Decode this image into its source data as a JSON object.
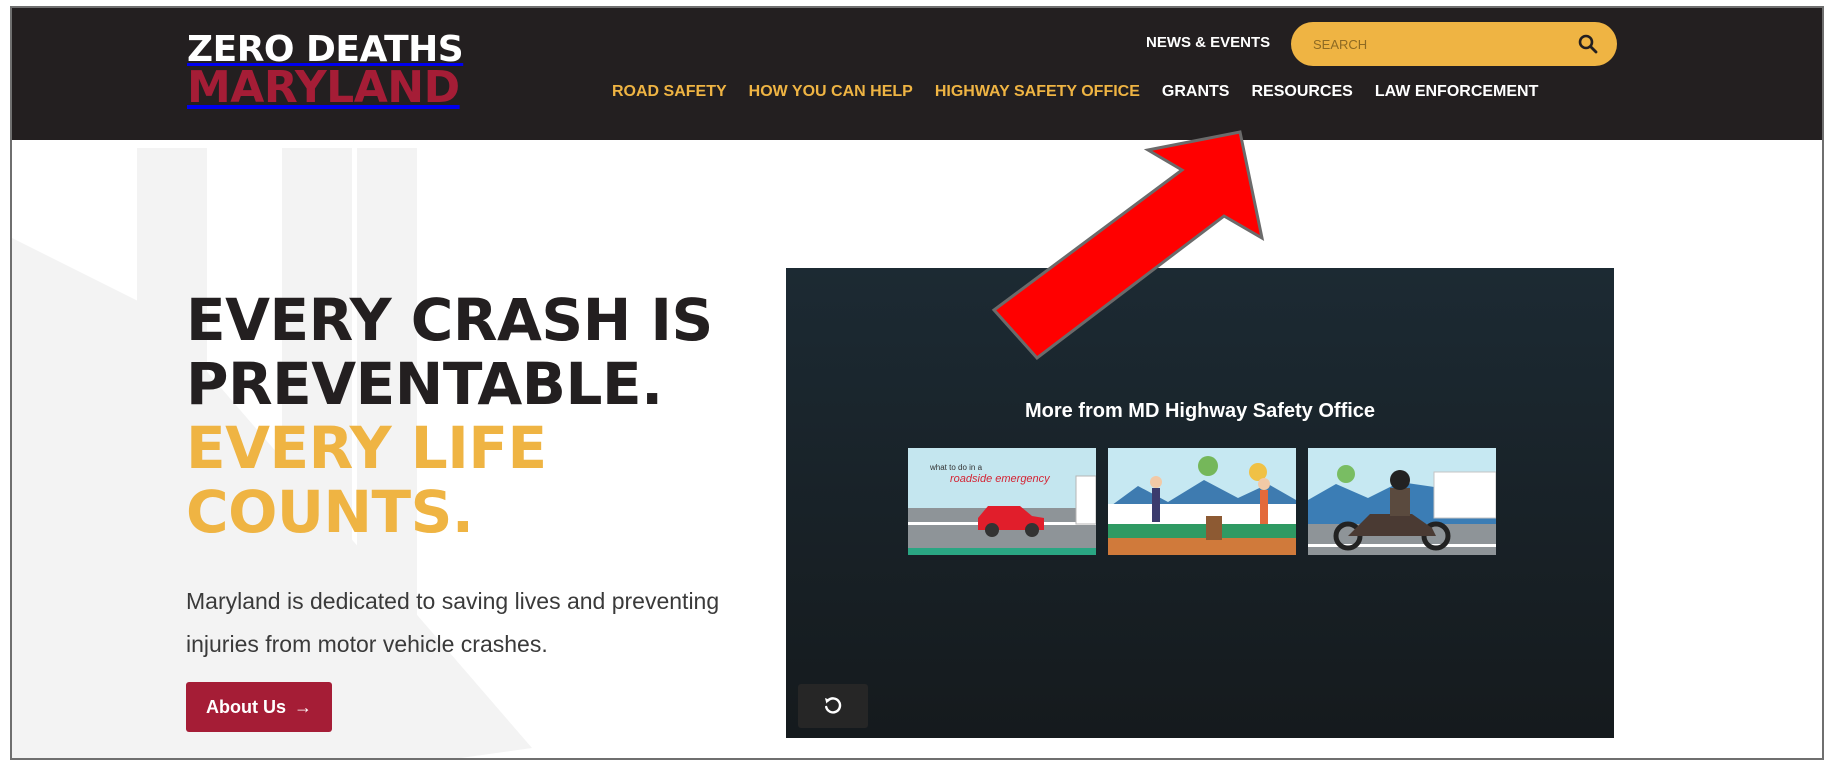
{
  "header": {
    "logo": {
      "line1": "ZERO DEATHS",
      "line2": "MARYLAND"
    },
    "top_link": "NEWS & EVENTS",
    "search": {
      "placeholder": "SEARCH",
      "icon": "search-icon"
    },
    "nav": [
      {
        "label": "ROAD SAFETY"
      },
      {
        "label": "HOW YOU CAN HELP"
      },
      {
        "label": "HIGHWAY SAFETY OFFICE"
      },
      {
        "label": "GRANTS"
      },
      {
        "label": "RESOURCES"
      },
      {
        "label": "LAW ENFORCEMENT"
      }
    ]
  },
  "hero": {
    "headline_line1": "EVERY CRASH IS",
    "headline_line2": "PREVENTABLE.",
    "headline_line3": "EVERY LIFE",
    "headline_line4": "COUNTS.",
    "description": "Maryland is dedicated to saving lives and preventing injuries from motor vehicle crashes.",
    "button": {
      "label": "About Us",
      "arrow": "→"
    }
  },
  "video": {
    "heading": "More from MD Highway Safety Office",
    "thumbnails": [
      {
        "caption_small": "what to do in a",
        "caption_large": "roadside emergency"
      },
      {
        "caption_small": "",
        "caption_large": ""
      },
      {
        "caption_small": "",
        "caption_large": ""
      }
    ],
    "replay_icon": "replay-icon"
  },
  "annotation": {
    "icon": "red-arrow-pointing-to-grants"
  },
  "colors": {
    "header_bg": "#231f20",
    "gold": "#efb443",
    "maroon": "#a51d36",
    "video_bg": "#1a2228",
    "arrow_red": "#ff0000"
  }
}
